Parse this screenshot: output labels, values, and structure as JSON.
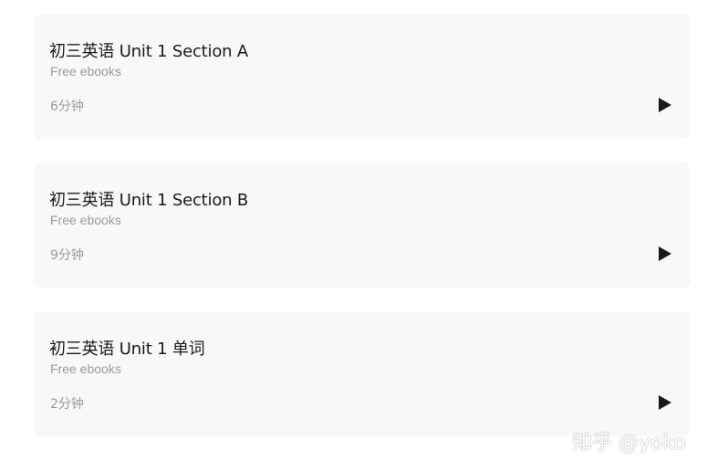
{
  "tracks": [
    {
      "title": "初三英语 Unit 1 Section A",
      "subtitle": "Free ebooks",
      "duration": "6分钟",
      "play_icon": "play-icon"
    },
    {
      "title": "初三英语 Unit 1 Section B",
      "subtitle": "Free ebooks",
      "duration": "9分钟",
      "play_icon": "play-icon"
    },
    {
      "title": "初三英语 Unit 1 单词",
      "subtitle": "Free ebooks",
      "duration": "2分钟",
      "play_icon": "play-icon"
    }
  ],
  "watermark": "知乎 @yoko",
  "colors": {
    "card_background": "#f8f8f8",
    "title_text": "#1a1a1a",
    "secondary_text": "#9a9a9a",
    "play_icon": "#1a1a1a"
  }
}
